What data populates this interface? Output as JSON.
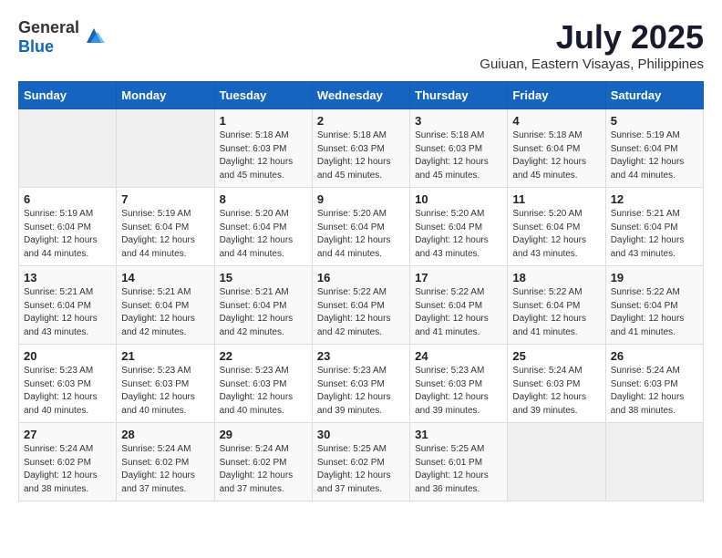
{
  "header": {
    "logo_general": "General",
    "logo_blue": "Blue",
    "title": "July 2025",
    "subtitle": "Guiuan, Eastern Visayas, Philippines"
  },
  "weekdays": [
    "Sunday",
    "Monday",
    "Tuesday",
    "Wednesday",
    "Thursday",
    "Friday",
    "Saturday"
  ],
  "weeks": [
    [
      {
        "day": "",
        "info": ""
      },
      {
        "day": "",
        "info": ""
      },
      {
        "day": "1",
        "info": "Sunrise: 5:18 AM\nSunset: 6:03 PM\nDaylight: 12 hours and 45 minutes."
      },
      {
        "day": "2",
        "info": "Sunrise: 5:18 AM\nSunset: 6:03 PM\nDaylight: 12 hours and 45 minutes."
      },
      {
        "day": "3",
        "info": "Sunrise: 5:18 AM\nSunset: 6:03 PM\nDaylight: 12 hours and 45 minutes."
      },
      {
        "day": "4",
        "info": "Sunrise: 5:18 AM\nSunset: 6:04 PM\nDaylight: 12 hours and 45 minutes."
      },
      {
        "day": "5",
        "info": "Sunrise: 5:19 AM\nSunset: 6:04 PM\nDaylight: 12 hours and 44 minutes."
      }
    ],
    [
      {
        "day": "6",
        "info": "Sunrise: 5:19 AM\nSunset: 6:04 PM\nDaylight: 12 hours and 44 minutes."
      },
      {
        "day": "7",
        "info": "Sunrise: 5:19 AM\nSunset: 6:04 PM\nDaylight: 12 hours and 44 minutes."
      },
      {
        "day": "8",
        "info": "Sunrise: 5:20 AM\nSunset: 6:04 PM\nDaylight: 12 hours and 44 minutes."
      },
      {
        "day": "9",
        "info": "Sunrise: 5:20 AM\nSunset: 6:04 PM\nDaylight: 12 hours and 44 minutes."
      },
      {
        "day": "10",
        "info": "Sunrise: 5:20 AM\nSunset: 6:04 PM\nDaylight: 12 hours and 43 minutes."
      },
      {
        "day": "11",
        "info": "Sunrise: 5:20 AM\nSunset: 6:04 PM\nDaylight: 12 hours and 43 minutes."
      },
      {
        "day": "12",
        "info": "Sunrise: 5:21 AM\nSunset: 6:04 PM\nDaylight: 12 hours and 43 minutes."
      }
    ],
    [
      {
        "day": "13",
        "info": "Sunrise: 5:21 AM\nSunset: 6:04 PM\nDaylight: 12 hours and 43 minutes."
      },
      {
        "day": "14",
        "info": "Sunrise: 5:21 AM\nSunset: 6:04 PM\nDaylight: 12 hours and 42 minutes."
      },
      {
        "day": "15",
        "info": "Sunrise: 5:21 AM\nSunset: 6:04 PM\nDaylight: 12 hours and 42 minutes."
      },
      {
        "day": "16",
        "info": "Sunrise: 5:22 AM\nSunset: 6:04 PM\nDaylight: 12 hours and 42 minutes."
      },
      {
        "day": "17",
        "info": "Sunrise: 5:22 AM\nSunset: 6:04 PM\nDaylight: 12 hours and 41 minutes."
      },
      {
        "day": "18",
        "info": "Sunrise: 5:22 AM\nSunset: 6:04 PM\nDaylight: 12 hours and 41 minutes."
      },
      {
        "day": "19",
        "info": "Sunrise: 5:22 AM\nSunset: 6:04 PM\nDaylight: 12 hours and 41 minutes."
      }
    ],
    [
      {
        "day": "20",
        "info": "Sunrise: 5:23 AM\nSunset: 6:03 PM\nDaylight: 12 hours and 40 minutes."
      },
      {
        "day": "21",
        "info": "Sunrise: 5:23 AM\nSunset: 6:03 PM\nDaylight: 12 hours and 40 minutes."
      },
      {
        "day": "22",
        "info": "Sunrise: 5:23 AM\nSunset: 6:03 PM\nDaylight: 12 hours and 40 minutes."
      },
      {
        "day": "23",
        "info": "Sunrise: 5:23 AM\nSunset: 6:03 PM\nDaylight: 12 hours and 39 minutes."
      },
      {
        "day": "24",
        "info": "Sunrise: 5:23 AM\nSunset: 6:03 PM\nDaylight: 12 hours and 39 minutes."
      },
      {
        "day": "25",
        "info": "Sunrise: 5:24 AM\nSunset: 6:03 PM\nDaylight: 12 hours and 39 minutes."
      },
      {
        "day": "26",
        "info": "Sunrise: 5:24 AM\nSunset: 6:03 PM\nDaylight: 12 hours and 38 minutes."
      }
    ],
    [
      {
        "day": "27",
        "info": "Sunrise: 5:24 AM\nSunset: 6:02 PM\nDaylight: 12 hours and 38 minutes."
      },
      {
        "day": "28",
        "info": "Sunrise: 5:24 AM\nSunset: 6:02 PM\nDaylight: 12 hours and 37 minutes."
      },
      {
        "day": "29",
        "info": "Sunrise: 5:24 AM\nSunset: 6:02 PM\nDaylight: 12 hours and 37 minutes."
      },
      {
        "day": "30",
        "info": "Sunrise: 5:25 AM\nSunset: 6:02 PM\nDaylight: 12 hours and 37 minutes."
      },
      {
        "day": "31",
        "info": "Sunrise: 5:25 AM\nSunset: 6:01 PM\nDaylight: 12 hours and 36 minutes."
      },
      {
        "day": "",
        "info": ""
      },
      {
        "day": "",
        "info": ""
      }
    ]
  ]
}
